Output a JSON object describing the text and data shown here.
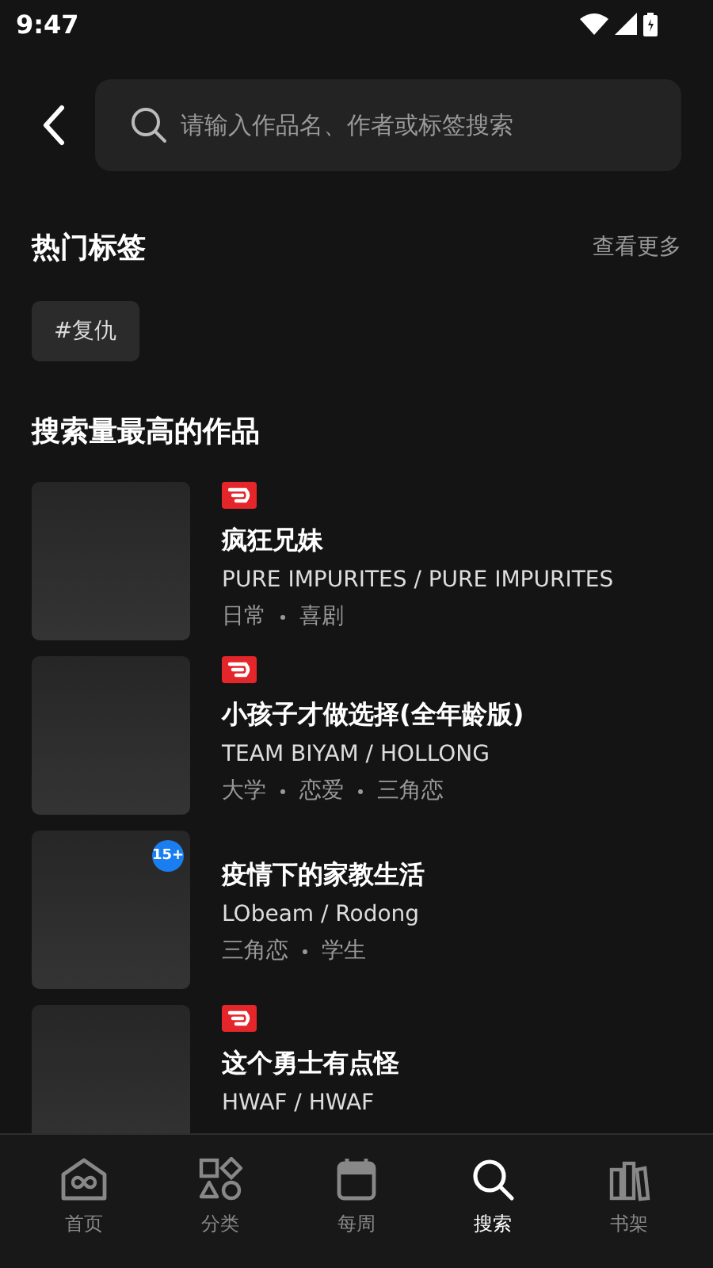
{
  "status_bar": {
    "time": "9:47"
  },
  "search": {
    "placeholder": "请输入作品名、作者或标签搜索"
  },
  "hot_tags": {
    "title": "热门标签",
    "more": "查看更多",
    "tags": [
      "#复仇"
    ]
  },
  "top_works": {
    "title": "搜索量最高的作品",
    "items": [
      {
        "title": "疯狂兄妹",
        "authors": "PURE IMPURITES / PURE IMPURITES",
        "genres": [
          "日常",
          "喜剧"
        ],
        "red_badge": true
      },
      {
        "title": "小孩子才做选择(全年龄版)",
        "authors": "TEAM BIYAM / HOLLONG",
        "genres": [
          "大学",
          "恋爱",
          "三角恋"
        ],
        "red_badge": true
      },
      {
        "title": "疫情下的家教生活",
        "authors": "LObeam / Rodong",
        "genres": [
          "三角恋",
          "学生"
        ],
        "red_badge": false,
        "age_badge": "15+"
      },
      {
        "title": "这个勇士有点怪",
        "authors": "HWAF / HWAF",
        "red_badge": true
      }
    ]
  },
  "bottom_nav": [
    {
      "label": "首页",
      "selected": false
    },
    {
      "label": "分类",
      "selected": false
    },
    {
      "label": "每周",
      "selected": false
    },
    {
      "label": "搜索",
      "selected": true
    },
    {
      "label": "书架",
      "selected": false
    }
  ]
}
